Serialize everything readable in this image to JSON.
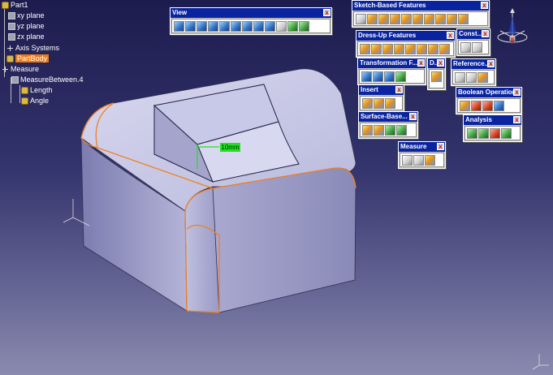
{
  "tree": {
    "root": "Part1",
    "planes": [
      "xy plane",
      "yz plane",
      "zx plane"
    ],
    "axis_systems": "Axis Systems",
    "part_body": "PartBody",
    "measure": "Measure",
    "measure_between": "MeasureBetween.4",
    "length": "Length",
    "angle": "Angle"
  },
  "dimension_label": "10mm",
  "toolbars": [
    {
      "id": "view",
      "title": "View",
      "tools": [
        "fly-mode",
        "fit-all",
        "pan",
        "rotate",
        "zoom-in",
        "zoom-out",
        "normal-view",
        "multi-view",
        "iso-view",
        "shading",
        "hide-show",
        "swap-space"
      ]
    },
    {
      "id": "sketch-based",
      "title": "Sketch-Based Features",
      "tools": [
        "pad",
        "pocket",
        "shaft",
        "groove",
        "hole",
        "rib",
        "slot",
        "stiffener",
        "multi-section-solid",
        "remove-multi-section"
      ]
    },
    {
      "id": "constraints",
      "title": "Const...",
      "tools": [
        "constraint",
        "constraint-dialog"
      ]
    },
    {
      "id": "dressup",
      "title": "Dress-Up Features",
      "tools": [
        "edge-fillet",
        "chamfer",
        "draft",
        "shell",
        "thickness",
        "thread",
        "remove-face",
        "replace-face"
      ]
    },
    {
      "id": "transformation",
      "title": "Transformation F...",
      "tools": [
        "translation",
        "mirror",
        "rect-pattern",
        "scaling"
      ]
    },
    {
      "id": "d",
      "title": "D...",
      "tools": [
        "user-pattern"
      ]
    },
    {
      "id": "reference",
      "title": "Reference...",
      "tools": [
        "point",
        "line",
        "plane"
      ]
    },
    {
      "id": "insert",
      "title": "Insert",
      "tools": [
        "body",
        "geometrical-set",
        "ordered-set"
      ]
    },
    {
      "id": "boolean",
      "title": "Boolean Operations",
      "tools": [
        "assemble",
        "add",
        "remove",
        "intersect"
      ]
    },
    {
      "id": "surface-based",
      "title": "Surface-Base...",
      "tools": [
        "split",
        "thick-surface",
        "close-surface",
        "sew-surface"
      ]
    },
    {
      "id": "analysis",
      "title": "Analysis",
      "tools": [
        "draft-analysis",
        "curvature-analysis",
        "taper-analysis",
        "threads-analysis"
      ]
    },
    {
      "id": "measure",
      "title": "Measure",
      "tools": [
        "measure-between",
        "measure-item",
        "measure-inertia"
      ]
    }
  ],
  "colors": {
    "selection": "#f07810",
    "toolbar_title": "#0a24a0",
    "dimension": "#22e022",
    "part_face": "#b4b4d8",
    "fillet_edge": "#f08020"
  }
}
